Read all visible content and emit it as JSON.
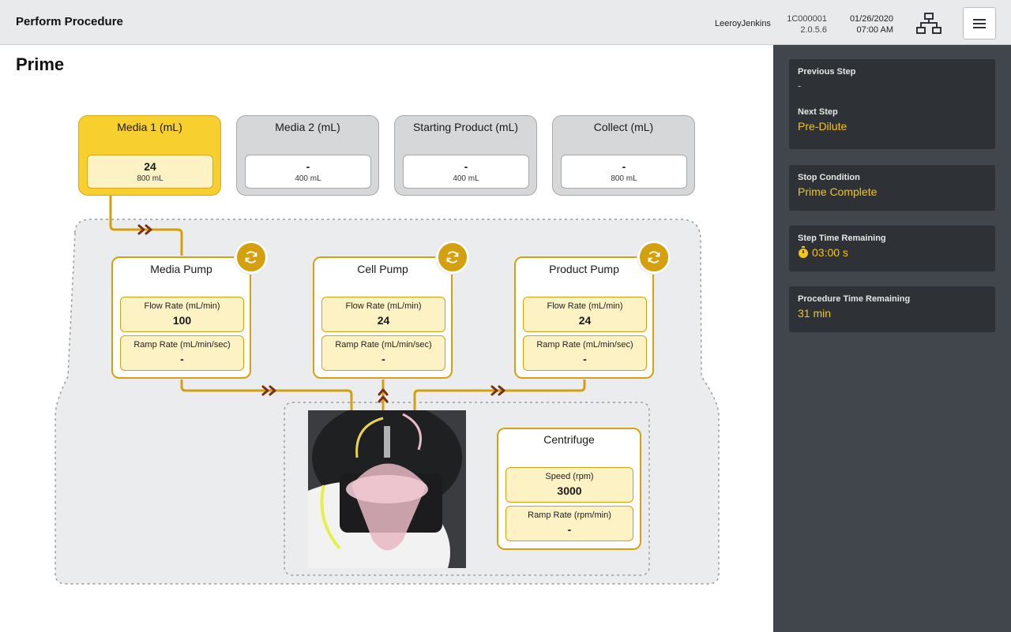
{
  "header": {
    "title": "Perform Procedure",
    "user": "LeeroyJenkins",
    "device_id": "1C000001",
    "version": "2.0.5.6",
    "date": "01/26/2020",
    "time": "07:00 AM",
    "network_icon": "network-icon",
    "menu_icon": "hamburger-menu-icon"
  },
  "page": {
    "title": "Prime"
  },
  "tanks": [
    {
      "name": "Media 1 (mL)",
      "value": "24",
      "capacity": "800 mL",
      "active": true
    },
    {
      "name": "Media 2 (mL)",
      "value": "-",
      "capacity": "400 mL",
      "active": false
    },
    {
      "name": "Starting Product (mL)",
      "value": "-",
      "capacity": "400 mL",
      "active": false
    },
    {
      "name": "Collect (mL)",
      "value": "-",
      "capacity": "800 mL",
      "active": false
    }
  ],
  "pumps": [
    {
      "name": "Media Pump",
      "flow_label": "Flow Rate (mL/min)",
      "flow_value": "100",
      "ramp_label": "Ramp Rate (mL/min/sec)",
      "ramp_value": "-"
    },
    {
      "name": "Cell Pump",
      "flow_label": "Flow Rate (mL/min)",
      "flow_value": "24",
      "ramp_label": "Ramp Rate (mL/min/sec)",
      "ramp_value": "-"
    },
    {
      "name": "Product Pump",
      "flow_label": "Flow Rate (mL/min)",
      "flow_value": "24",
      "ramp_label": "Ramp Rate (mL/min/sec)",
      "ramp_value": "-"
    }
  ],
  "centrifuge": {
    "name": "Centrifuge",
    "speed_label": "Speed (rpm)",
    "speed_value": "3000",
    "ramp_label": "Ramp Rate (rpm/min)",
    "ramp_value": "-"
  },
  "sidebar": {
    "previous_step_label": "Previous Step",
    "previous_step_value": "-",
    "next_step_label": "Next Step",
    "next_step_value": "Pre-Dilute",
    "stop_condition_label": "Stop Condition",
    "stop_condition_value": "Prime Complete",
    "step_time_label": "Step Time Remaining",
    "step_time_value": "03:00 s",
    "procedure_time_label": "Procedure Time Remaining",
    "procedure_time_value": "31 min"
  },
  "colors": {
    "accent": "#f7cf2e",
    "line": "#d4a00d",
    "arrow": "#7a2e12",
    "sidebar_bg": "#41464c",
    "card_bg": "#2e3237",
    "value_text": "#f5c518"
  }
}
